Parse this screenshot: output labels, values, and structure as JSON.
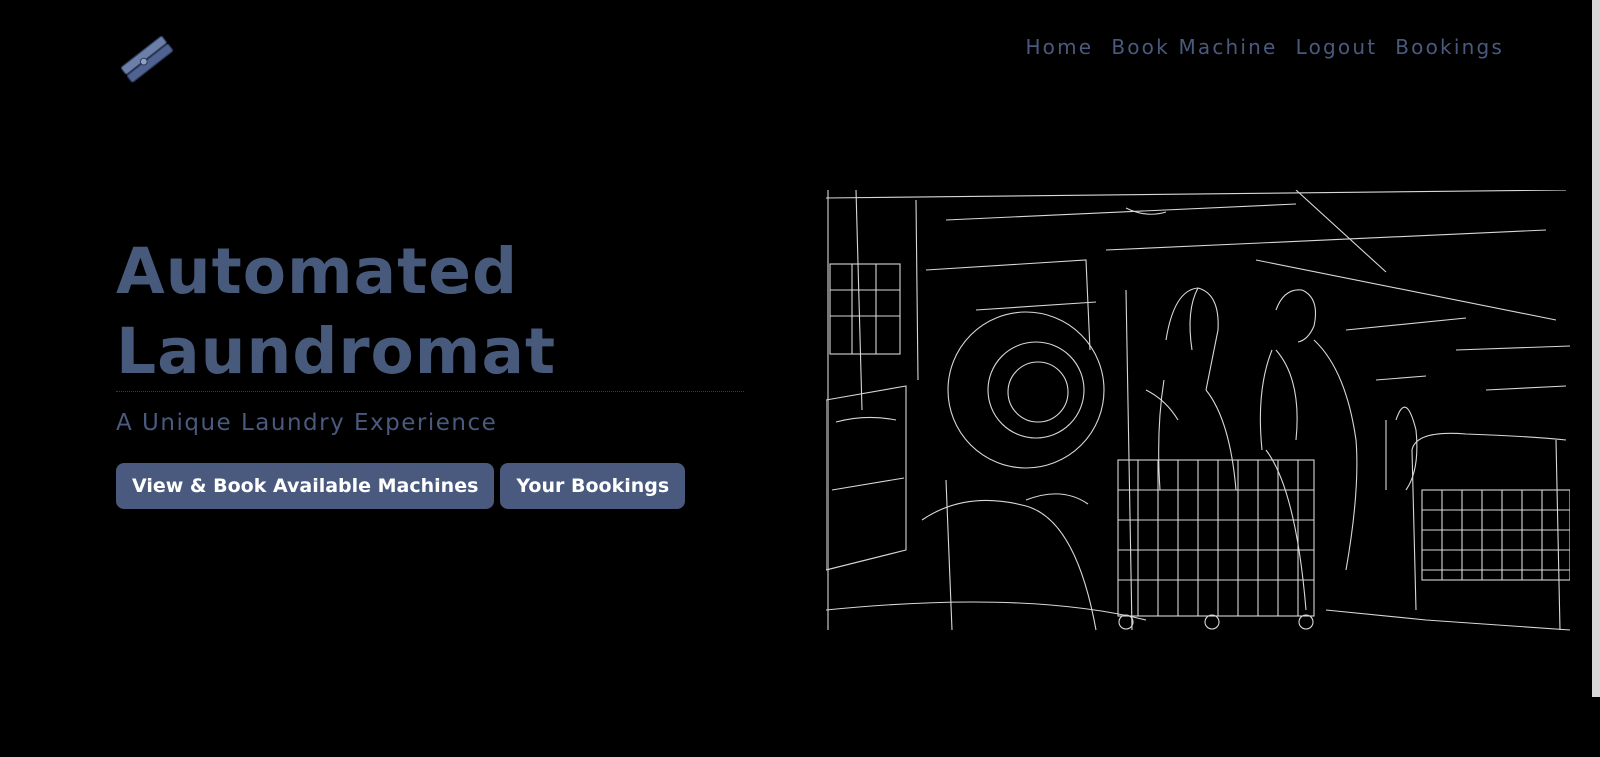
{
  "nav": {
    "items": [
      {
        "label": "Home"
      },
      {
        "label": "Book Machine"
      },
      {
        "label": "Logout"
      },
      {
        "label": "Bookings"
      }
    ]
  },
  "hero": {
    "title_line1": "Automated",
    "title_line2": "Laundromat",
    "subtitle": "A Unique Laundry Experience",
    "primary_button": "View & Book Available Machines",
    "secondary_button": "Your Bookings"
  },
  "icons": {
    "logo": "clothespin-icon"
  },
  "colors": {
    "background": "#000000",
    "accent": "#4a5a7e",
    "button_text": "#ffffff"
  }
}
